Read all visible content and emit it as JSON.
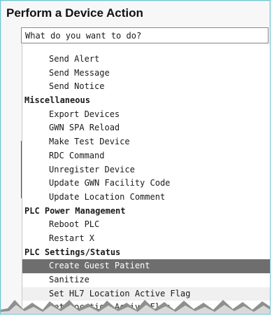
{
  "dialog": {
    "title": "Perform a Device Action",
    "search_placeholder": "What do you want to do?"
  },
  "menu": {
    "rows": [
      {
        "label": "Send Alert",
        "kind": "item"
      },
      {
        "label": "Send Message",
        "kind": "item"
      },
      {
        "label": "Send Notice",
        "kind": "item"
      },
      {
        "label": "Miscellaneous",
        "kind": "group"
      },
      {
        "label": "Export Devices",
        "kind": "item"
      },
      {
        "label": "GWN SPA Reload",
        "kind": "item"
      },
      {
        "label": "Make Test Device",
        "kind": "item"
      },
      {
        "label": "RDC Command",
        "kind": "item"
      },
      {
        "label": "Unregister Device",
        "kind": "item"
      },
      {
        "label": "Update GWN Facility Code",
        "kind": "item"
      },
      {
        "label": "Update Location Comment",
        "kind": "item"
      },
      {
        "label": "PLC Power Management",
        "kind": "group"
      },
      {
        "label": "Reboot PLC",
        "kind": "item"
      },
      {
        "label": "Restart X",
        "kind": "item"
      },
      {
        "label": "PLC Settings/Status",
        "kind": "group"
      },
      {
        "label": "Create Guest Patient",
        "kind": "item",
        "selected": true
      },
      {
        "label": "Sanitize",
        "kind": "item"
      },
      {
        "label": "Set HL7 Location Active Flag",
        "kind": "item",
        "highlight": true
      },
      {
        "label": "Set Location Active Flag",
        "kind": "item"
      }
    ]
  },
  "colors": {
    "border_accent": "#6fc3cf",
    "selected_bg": "#6e6e6e",
    "side_accent": "#5d3a86"
  }
}
